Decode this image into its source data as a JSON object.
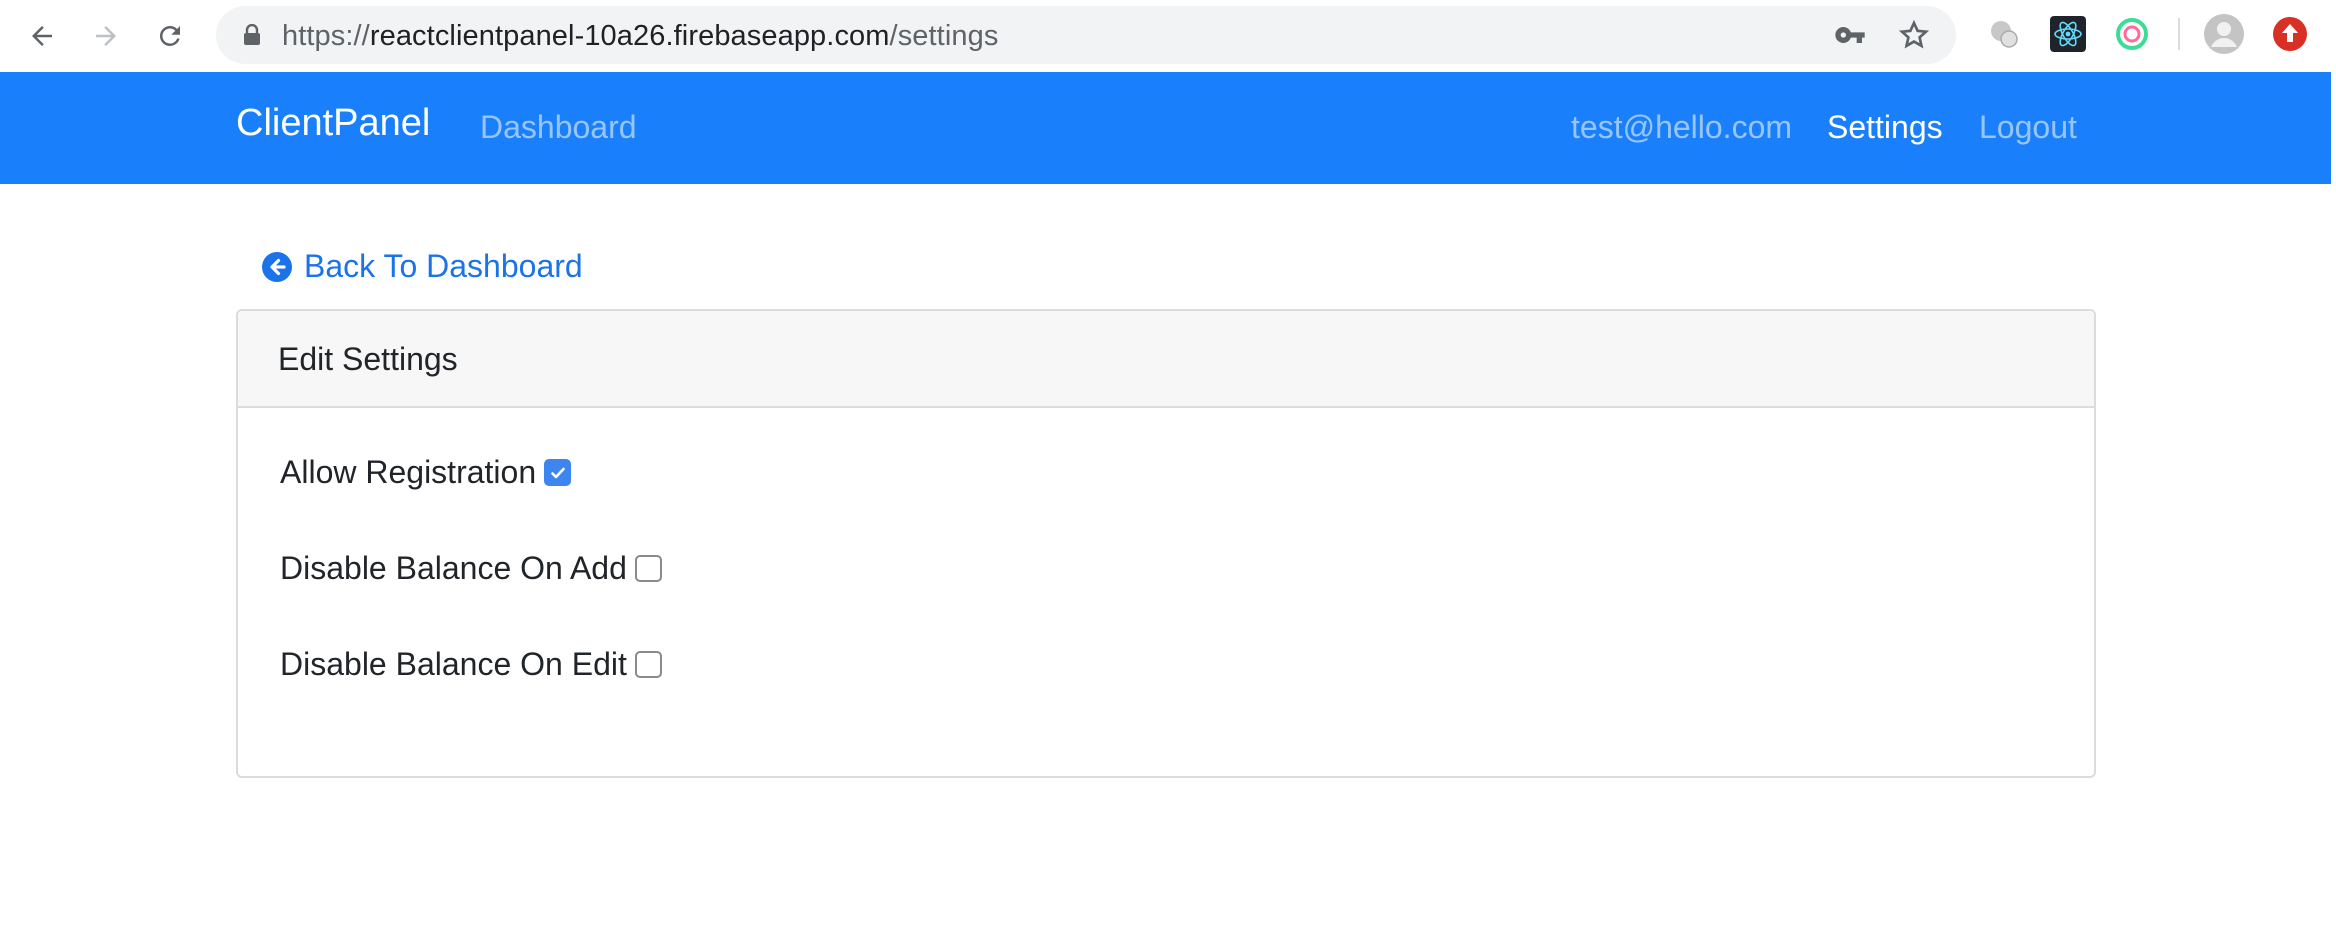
{
  "browser": {
    "url_secure": "https://",
    "url_host": "reactclientpanel-10a26.firebaseapp.com",
    "url_path": "/settings",
    "icons": [
      "back-arrow-icon",
      "forward-arrow-icon",
      "reload-icon",
      "lock-icon",
      "key-icon",
      "star-icon",
      "extension-icon",
      "react-devtools-icon",
      "extension-ring-icon",
      "profile-avatar-icon",
      "update-icon"
    ]
  },
  "navbar": {
    "brand": "ClientPanel",
    "dashboard_label": "Dashboard",
    "user_email": "test@hello.com",
    "settings_label": "Settings",
    "logout_label": "Logout",
    "color": "#1a7ffb"
  },
  "page": {
    "back_link_label": "Back To Dashboard",
    "card_title": "Edit Settings",
    "settings": [
      {
        "label": "Allow Registration",
        "checked": true
      },
      {
        "label": "Disable Balance On Add",
        "checked": false
      },
      {
        "label": "Disable Balance On Edit",
        "checked": false
      }
    ]
  }
}
